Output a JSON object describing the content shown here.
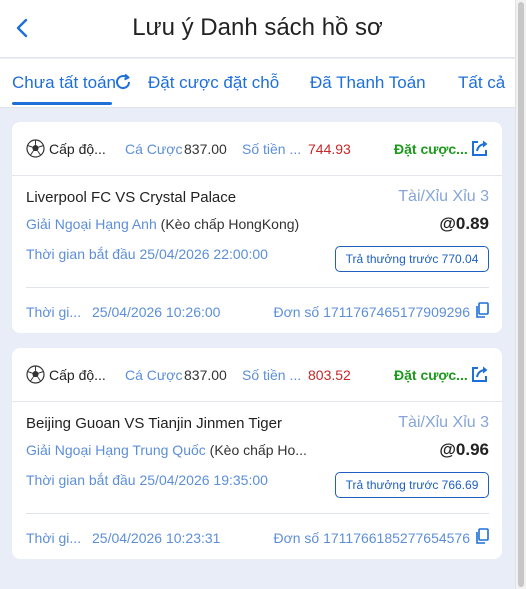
{
  "header": {
    "title": "Lưu ý Danh sách hồ sơ"
  },
  "tabs": [
    {
      "label": "Chưa tất toán"
    },
    {
      "label": "Đặt cược đặt chỗ"
    },
    {
      "label": "Đã Thanh Toán"
    },
    {
      "label": "Tất cả"
    }
  ],
  "icons": {
    "back": "chevron-left-icon",
    "refresh": "refresh-icon",
    "ball": "soccer-ball-icon",
    "share": "share-icon",
    "copy": "copy-icon"
  },
  "colors": {
    "accent": "#1e6fd9",
    "status_green": "#1c9a1c",
    "amount_red": "#c62828",
    "label_blue": "#5d8fd8"
  },
  "bets": [
    {
      "level": "Cấp độ...",
      "stake_label": "Cá Cược",
      "stake_value": "837.00",
      "amount_label": "Số tiền ...",
      "amount_value": "744.93",
      "status": "Đặt cược...",
      "match": "Liverpool FC VS Crystal Palace",
      "bet_type": "Tài/Xỉu Xỉu 3",
      "league": "Giải Ngoại Hạng Anh",
      "handicap": "(Kèo chấp HongKong)",
      "odds": "@0.89",
      "start_time": "Thời gian bắt đầu 25/04/2026 22:00:00",
      "early_payout": "Trả thưởng trước 770.04",
      "time_label": "Thời gi...",
      "time_value": "25/04/2026 10:26:00",
      "order_no": "Đơn số 1711767465177909296"
    },
    {
      "level": "Cấp độ...",
      "stake_label": "Cá Cược",
      "stake_value": "837.00",
      "amount_label": "Số tiền ...",
      "amount_value": "803.52",
      "status": "Đặt cược...",
      "match": "Beijing Guoan VS Tianjin Jinmen Tiger",
      "bet_type": "Tài/Xỉu Xỉu 3",
      "league": "Giải Ngoại Hạng Trung Quốc",
      "handicap": "(Kèo chấp Ho...",
      "odds": "@0.96",
      "start_time": "Thời gian bắt đầu 25/04/2026 19:35:00",
      "early_payout": "Trả thưởng trước 766.69",
      "time_label": "Thời gi...",
      "time_value": "25/04/2026 10:23:31",
      "order_no": "Đơn số 1711766185277654576"
    }
  ]
}
